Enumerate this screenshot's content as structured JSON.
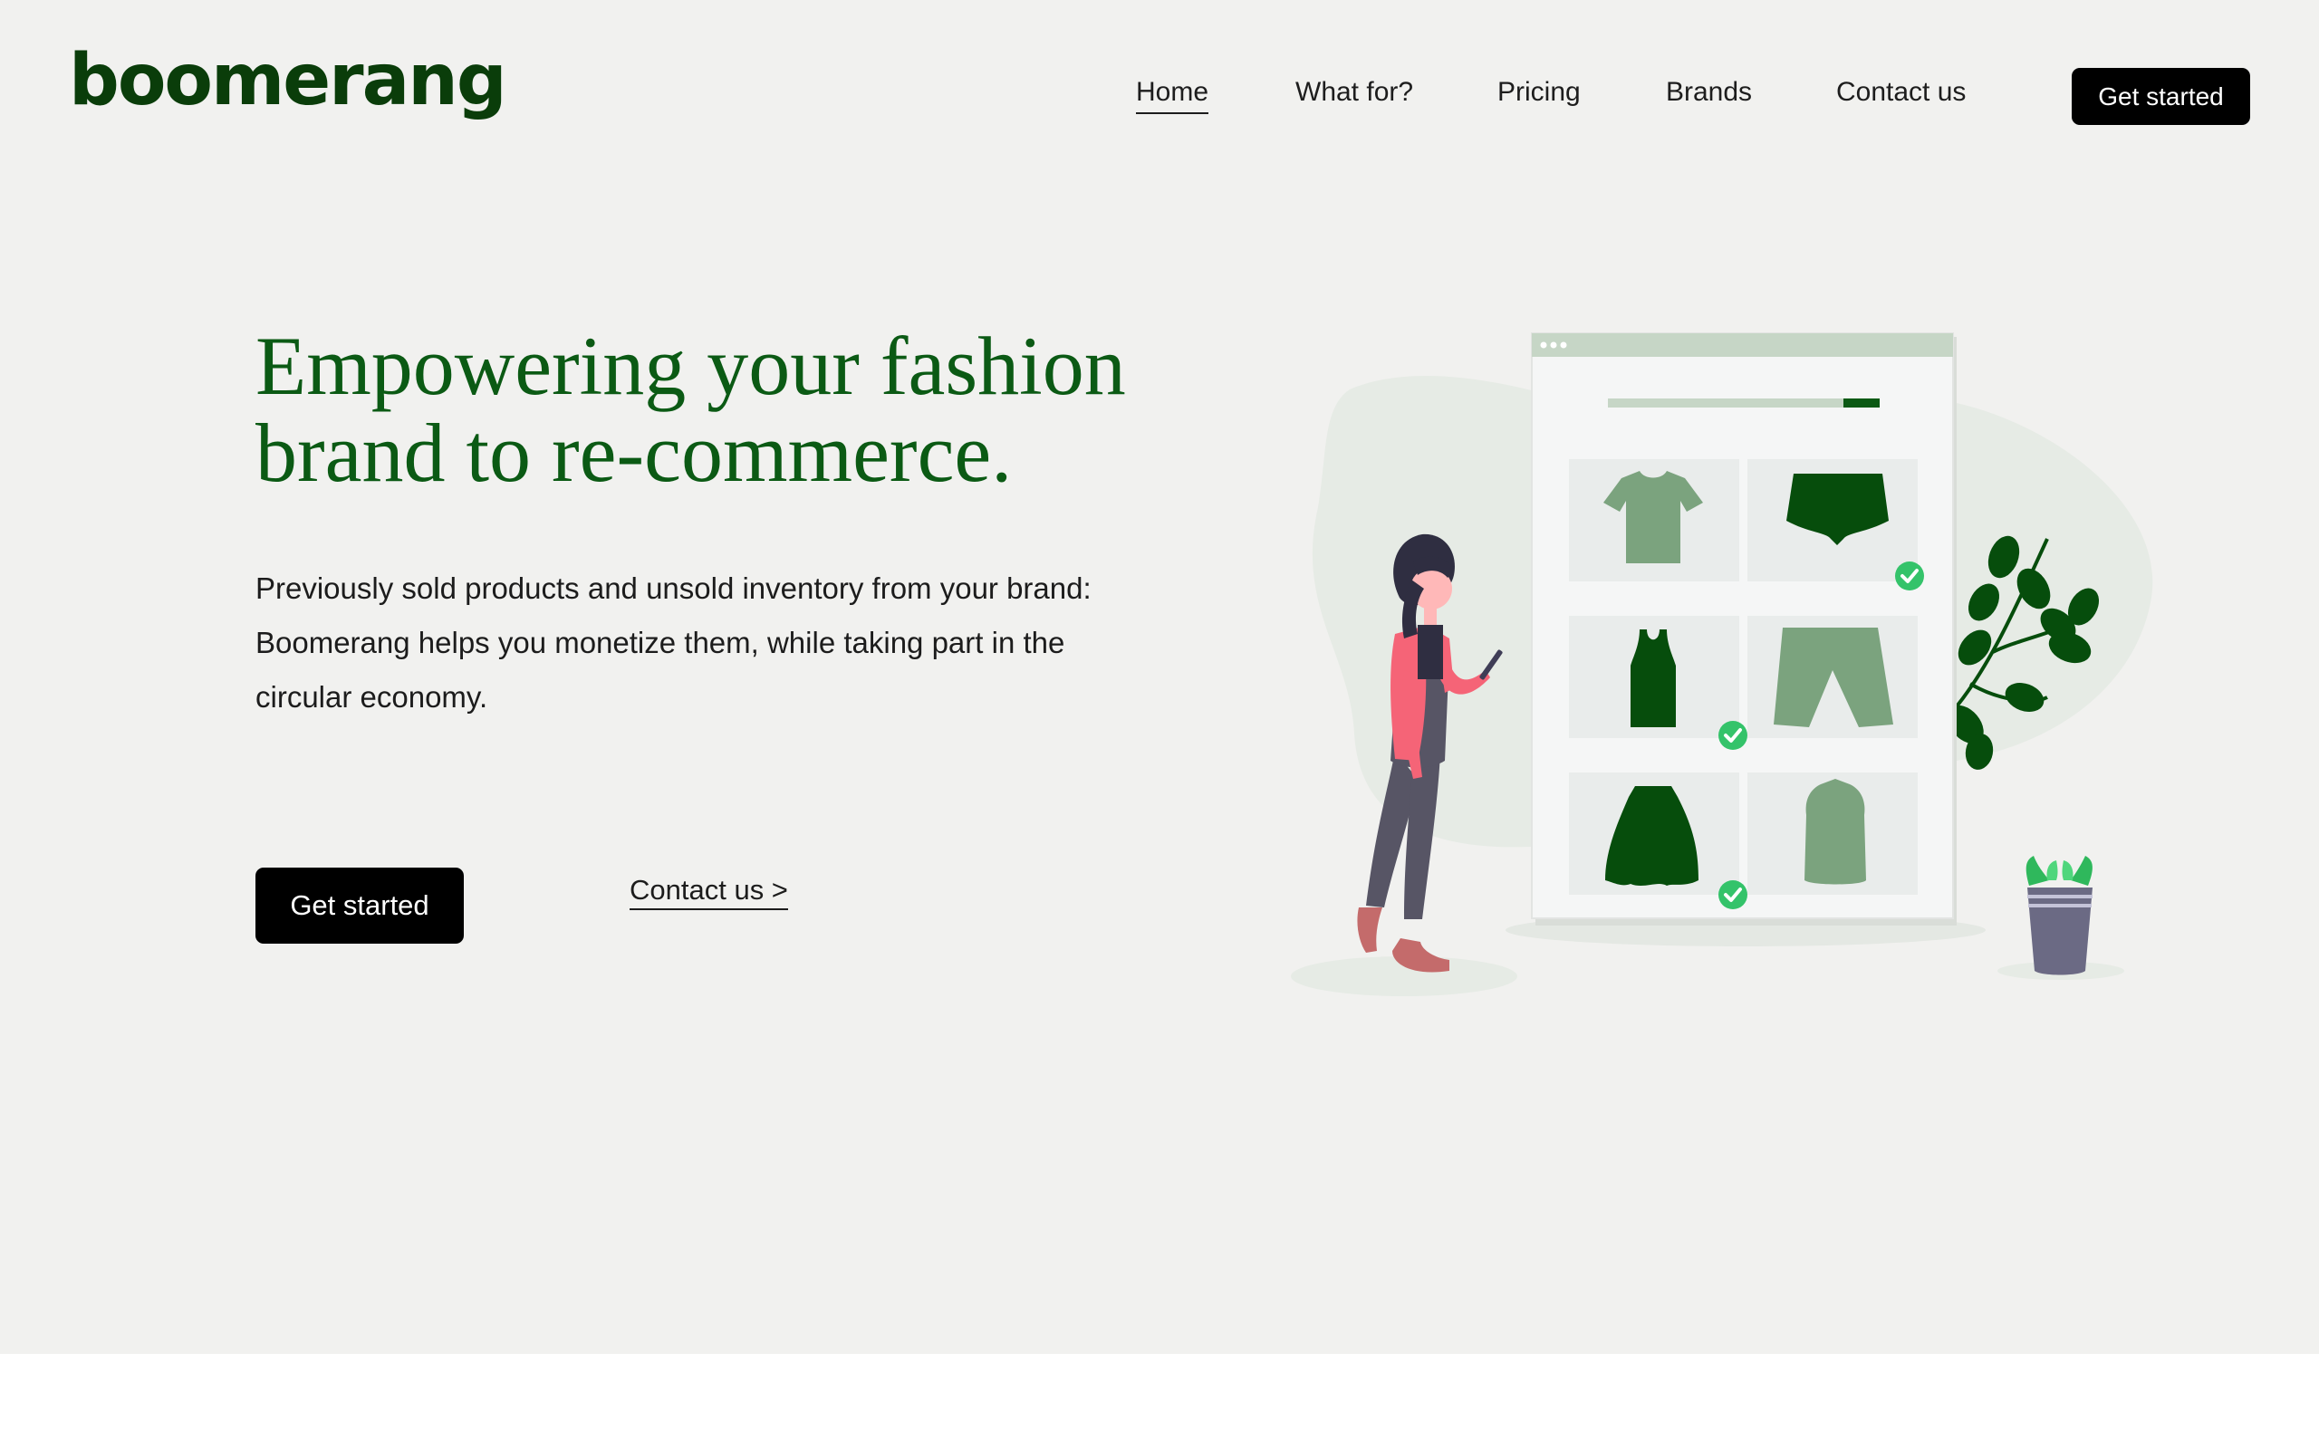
{
  "brand": {
    "logo_text": "boomerang"
  },
  "nav": {
    "items": [
      {
        "label": "Home",
        "active": true
      },
      {
        "label": "What for?",
        "active": false
      },
      {
        "label": "Pricing",
        "active": false
      },
      {
        "label": "Brands",
        "active": false
      },
      {
        "label": "Contact us",
        "active": false
      }
    ],
    "cta_label": "Get started"
  },
  "hero": {
    "headline_line1": "Empowering your fashion",
    "headline_line2": "brand to re-commerce.",
    "description_line1": "Previously sold products and unsold inventory from your brand:",
    "description_line2": "Boomerang helps you monetize them, while taking part in the",
    "description_line3": "circular economy.",
    "primary_cta": "Get started",
    "secondary_cta": "Contact us >"
  },
  "colors": {
    "hero_background": "#f1f1ef",
    "brand_green": "#0b5a14",
    "logo_green": "#0a3d0a",
    "button_black": "#000000",
    "check_green": "#34c36a"
  },
  "illustration": {
    "subject": "woman-with-phone-browsing-clothing-catalog",
    "catalog_items": [
      "t-shirt",
      "shorts-dark",
      "tank-top",
      "shorts-light",
      "skirt",
      "vest"
    ],
    "checked_items": [
      "shorts-dark",
      "tank-top",
      "skirt"
    ]
  }
}
